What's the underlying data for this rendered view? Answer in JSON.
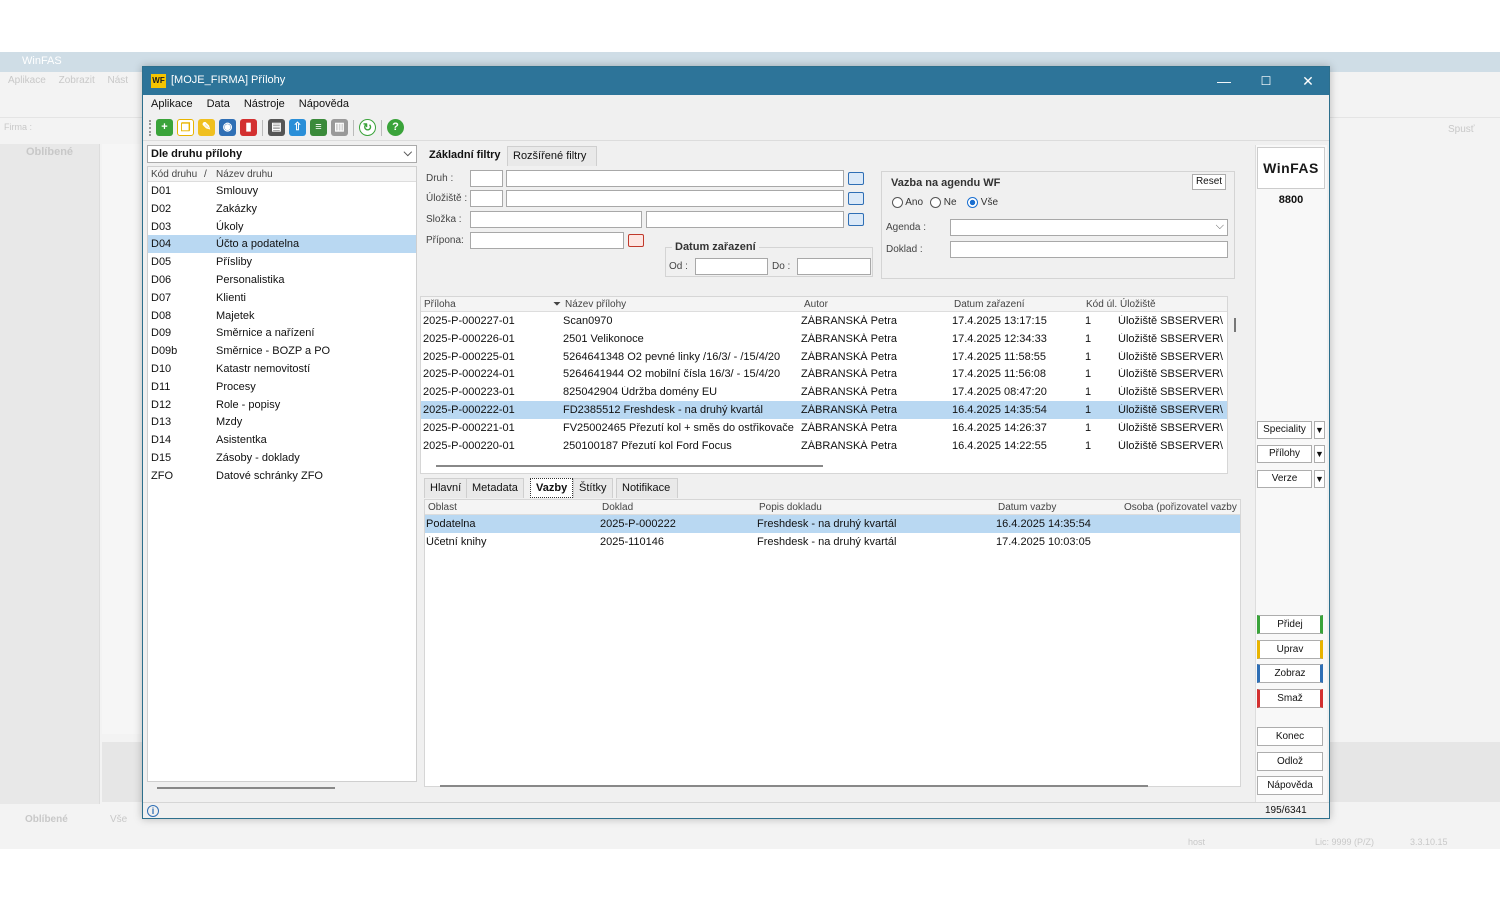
{
  "bg": {
    "title": "WinFAS",
    "menu": [
      "Aplikace",
      "Zobrazit",
      "Nást"
    ],
    "firma_label": "Firma :",
    "left_label": "Oblíbené",
    "bottom_left": "Oblíbené",
    "bottom_vse": "Vše",
    "spust": "Spusť",
    "status_host": "host",
    "status_lic": "Lic: 9999 (P/Z)",
    "status_ver": "3.3.10.15"
  },
  "window": {
    "logo": "WF",
    "title": "[MOJE_FIRMA] Přílohy",
    "minimize": "—",
    "maximize": "☐",
    "close": "✕"
  },
  "menu": [
    "Aplikace",
    "Data",
    "Nástroje",
    "Nápověda"
  ],
  "left": {
    "combo": "Dle druhu přílohy",
    "col_kod": "Kód druhu",
    "col_sort": "/",
    "col_nazev": "Název druhu",
    "rows": [
      [
        "D01",
        "Smlouvy"
      ],
      [
        "D02",
        "Zakázky"
      ],
      [
        "D03",
        "Úkoly"
      ],
      [
        "D04",
        "Účto a podatelna"
      ],
      [
        "D05",
        "Přísliby"
      ],
      [
        "D06",
        "Personalistika"
      ],
      [
        "D07",
        "Klienti"
      ],
      [
        "D08",
        "Majetek"
      ],
      [
        "D09",
        "Směrnice a nařízení"
      ],
      [
        "D09b",
        "Směrnice - BOZP a PO"
      ],
      [
        "D10",
        "Katastr nemovitostí"
      ],
      [
        "D11",
        "Procesy"
      ],
      [
        "D12",
        "Role - popisy"
      ],
      [
        "D13",
        "Mzdy"
      ],
      [
        "D14",
        "Asistentka"
      ],
      [
        "D15",
        "Zásoby - doklady"
      ],
      [
        "ZFO",
        "Datové schránky ZFO"
      ]
    ],
    "selected_index": 3
  },
  "tabs": {
    "zakladni": "Základní filtry",
    "rozsirene": "Rozšířené filtry"
  },
  "filters": {
    "druh": "Druh :",
    "uloziste": "Úložiště :",
    "slozka": "Složka :",
    "pripona": "Přípona:",
    "datum_title": "Datum zařazení",
    "od": "Od :",
    "do": "Do :"
  },
  "vazba": {
    "title": "Vazba na agendu WF",
    "reset": "Reset",
    "ano": "Ano",
    "ne": "Ne",
    "vse": "Vše",
    "selected": "Vše",
    "agenda": "Agenda :",
    "doklad": "Doklad :"
  },
  "grid": {
    "headers": [
      "Příloha",
      "Název přílohy",
      "Autor",
      "Datum zařazení",
      "Kód úl.",
      "Úložiště"
    ],
    "rows": [
      [
        "2025-P-000227-01",
        "Scan0970",
        "ZÁBRANSKÁ Petra",
        "17.4.2025 13:17:15",
        "1",
        "Úložiště SBSERVER\\"
      ],
      [
        "2025-P-000226-01",
        "2501 Velikonoce",
        "ZÁBRANSKÁ Petra",
        "17.4.2025 12:34:33",
        "1",
        "Úložiště SBSERVER\\"
      ],
      [
        "2025-P-000225-01",
        "5264641348 O2 pevné linky /16/3/ - /15/4/20",
        "ZÁBRANSKÁ Petra",
        "17.4.2025 11:58:55",
        "1",
        "Úložiště SBSERVER\\"
      ],
      [
        "2025-P-000224-01",
        "5264641944 O2 mobilní čísla 16/3/ - 15/4/20",
        "ZÁBRANSKÁ Petra",
        "17.4.2025 11:56:08",
        "1",
        "Úložiště SBSERVER\\"
      ],
      [
        "2025-P-000223-01",
        "825042904 Údržba domény EU",
        "ZÁBRANSKÁ Petra",
        "17.4.2025 08:47:20",
        "1",
        "Úložiště SBSERVER\\"
      ],
      [
        "2025-P-000222-01",
        "FD2385512 Freshdesk - na druhý kvartál",
        "ZÁBRANSKÁ Petra",
        "16.4.2025 14:35:54",
        "1",
        "Úložiště SBSERVER\\"
      ],
      [
        "2025-P-000221-01",
        "FV25002465 Přezutí kol + směs do ostřikovače",
        "ZÁBRANSKÁ Petra",
        "16.4.2025 14:26:37",
        "1",
        "Úložiště SBSERVER\\"
      ],
      [
        "2025-P-000220-01",
        "250100187 Přezutí kol Ford Focus",
        "ZÁBRANSKÁ Petra",
        "16.4.2025 14:22:55",
        "1",
        "Úložiště SBSERVER\\"
      ]
    ],
    "selected_index": 5
  },
  "detail_tabs": [
    "Hlavní",
    "Metadata",
    "Vazby",
    "Štítky",
    "Notifikace"
  ],
  "detail_active": "Vazby",
  "detail": {
    "headers": [
      "Oblast",
      "Doklad",
      "Popis dokladu",
      "Datum vazby",
      "Osoba (pořizovatel vazby"
    ],
    "rows": [
      [
        "Podatelna",
        "2025-P-000222",
        "Freshdesk - na druhý kvartál",
        "16.4.2025 14:35:54",
        ""
      ],
      [
        "Účetní knihy",
        "2025-110146",
        "Freshdesk - na druhý kvartál",
        "17.4.2025 10:03:05",
        ""
      ]
    ],
    "selected_index": 0
  },
  "right": {
    "brand": "WinFAS",
    "number": "8800",
    "specialty": "Speciality",
    "prilohy": "Přílohy",
    "verze": "Verze",
    "arrow": "▼",
    "pridej": "Přidej",
    "uprav": "Uprav",
    "zobraz": "Zobraz",
    "smaz": "Smaž",
    "konec": "Konec",
    "odloz": "Odlož",
    "napoveda": "Nápověda"
  },
  "status": {
    "info": "i",
    "count": "195/6341"
  },
  "colors": {
    "titlebar": "#2d7499",
    "selection": "#b9d8f2",
    "pridej": "#3aa33a",
    "uprav": "#e8b400",
    "zobraz": "#2f6fb5",
    "smaz": "#d33030"
  }
}
